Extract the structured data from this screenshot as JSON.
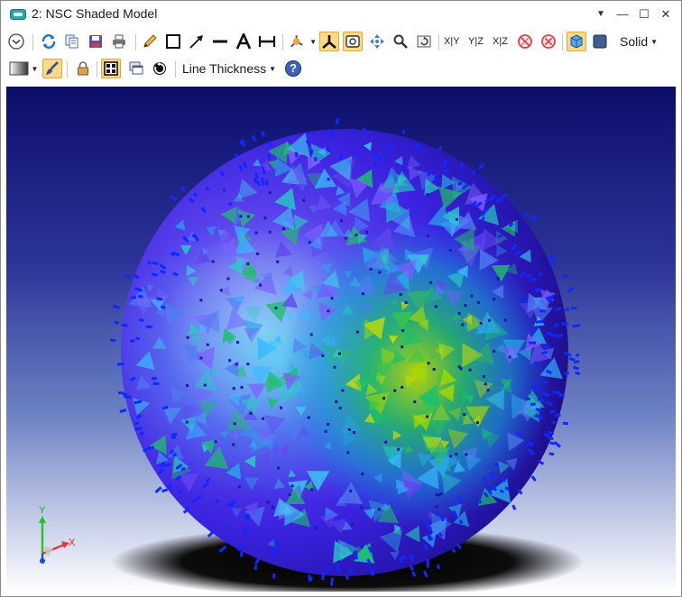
{
  "window": {
    "title": "2: NSC Shaded Model",
    "controls": {
      "dropdown": "▼",
      "minimize": "—",
      "maximize": "☐",
      "close": "✕"
    }
  },
  "toolbar": {
    "zoom_axis_labels": [
      "X|Y",
      "Y|Z",
      "X|Z"
    ],
    "render_mode": "Solid",
    "line_thickness": "Line Thickness",
    "help": "?"
  },
  "viewport": {
    "axis_labels": {
      "y": "Y",
      "x": "X"
    },
    "colors": {
      "background_top": "#0c0d6a",
      "background_bottom": "#ffffff",
      "sphere": "#3a22e0",
      "highlight": "#f0c8ff",
      "rays": "#1028ff"
    }
  }
}
